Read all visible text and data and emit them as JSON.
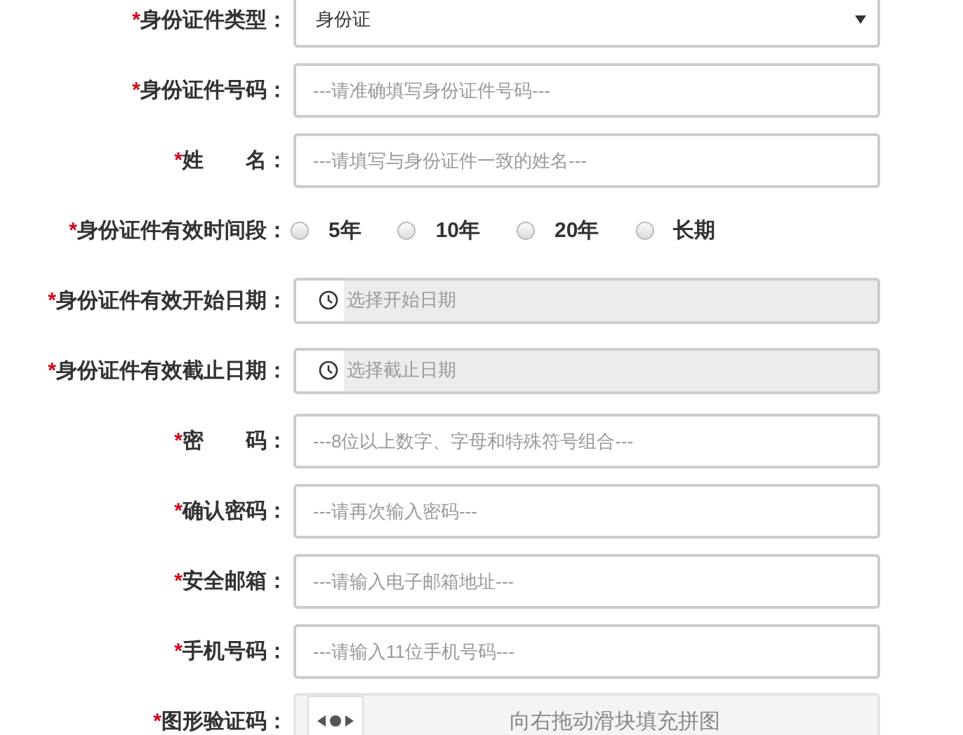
{
  "form": {
    "rows": [
      {
        "kind": "select",
        "required_mark": "*",
        "label": "身份证件类型：",
        "value": "身份证"
      },
      {
        "kind": "text",
        "required_mark": "*",
        "label": "身份证件号码：",
        "placeholder": "---请准确填写身份证件号码---"
      },
      {
        "kind": "text",
        "required_mark": "*",
        "label": "姓　　名：",
        "placeholder": "---请填写与身份证件一致的姓名---"
      },
      {
        "kind": "radio",
        "required_mark": "*",
        "label": "身份证件有效时间段：",
        "options": [
          {
            "label": "5年",
            "selected": false
          },
          {
            "label": "10年",
            "selected": false
          },
          {
            "label": "20年",
            "selected": false
          },
          {
            "label": "长期",
            "selected": false
          }
        ]
      },
      {
        "kind": "date",
        "required_mark": "*",
        "label": "身份证件有效开始日期：",
        "placeholder": "选择开始日期"
      },
      {
        "kind": "date",
        "required_mark": "*",
        "label": "身份证件有效截止日期：",
        "placeholder": "选择截止日期"
      },
      {
        "kind": "text",
        "required_mark": "*",
        "label": "密　　码：",
        "placeholder": "---8位以上数字、字母和特殊符号组合---"
      },
      {
        "kind": "text",
        "required_mark": "*",
        "label": "确认密码：",
        "placeholder": "---请再次输入密码---"
      },
      {
        "kind": "text",
        "required_mark": "*",
        "label": "安全邮箱：",
        "placeholder": "---请输入电子邮箱地址---"
      },
      {
        "kind": "text",
        "required_mark": "*",
        "label": "手机号码：",
        "placeholder": "---请输入11位手机号码---"
      },
      {
        "kind": "slider",
        "required_mark": "*",
        "label": "图形验证码：",
        "hint": "向右拖动滑块填充拼图",
        "level": 0
      }
    ]
  }
}
